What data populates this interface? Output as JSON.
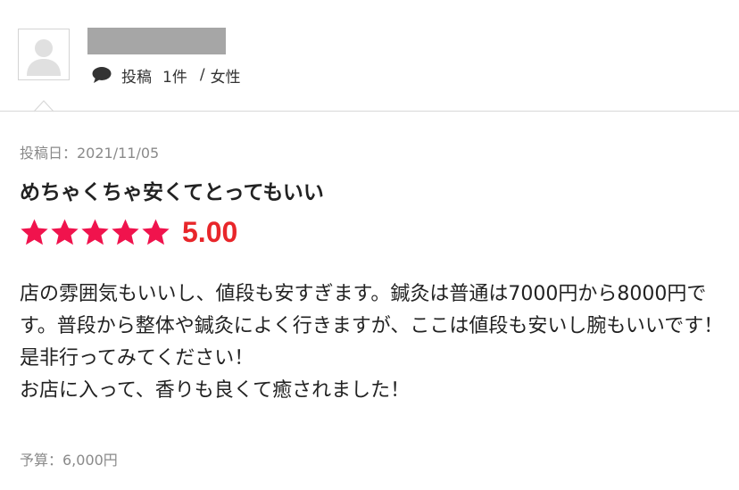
{
  "reviewer": {
    "avatar_icon": "user-silhouette-icon",
    "name_redacted_color": "#a6a6a6",
    "comment_icon": "speech-bubble-icon",
    "post_label": "投稿",
    "post_count": "1件",
    "separator": "/",
    "gender": "女性"
  },
  "review": {
    "date_label": "投稿日：2021/11/05",
    "title": "めちゃくちゃ安くてとってもいい",
    "rating": {
      "value": 5,
      "max": 5,
      "score_text": "5.00",
      "star_color": "#f0134d",
      "score_color": "#e8262a"
    },
    "body_line1": "店の雰囲気もいいし、値段も安すぎます。鍼灸は普通は7000円から8000円です。普段から整体や鍼灸によく行きますが、ここは値段も安いし腕もいいです！是非行ってみてください！",
    "body_line2": "お店に入って、香りも良くて癒されました！",
    "budget_label": "予算：6,000円"
  }
}
